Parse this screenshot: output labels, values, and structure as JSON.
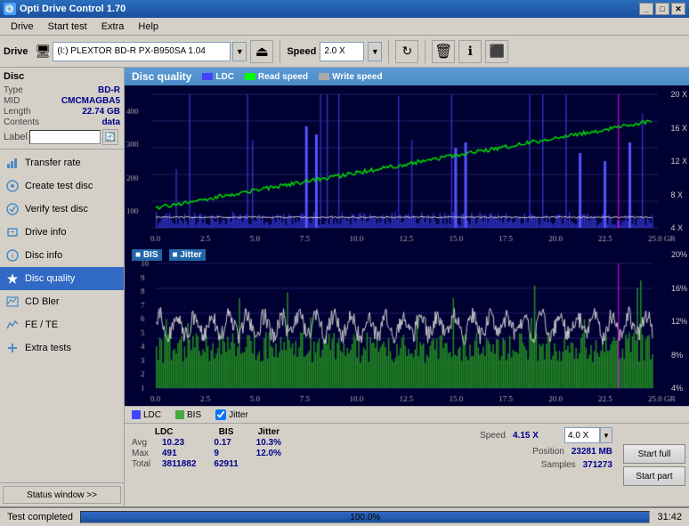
{
  "window": {
    "title": "Opti Drive Control 1.70",
    "titleIcon": "💿"
  },
  "menu": {
    "items": [
      "Drive",
      "Start test",
      "Extra",
      "Help"
    ]
  },
  "toolbar": {
    "drive_label": "Drive",
    "drive_icon": "🖥",
    "drive_value": "(I:)  PLEXTOR BD-R  PX-B950SA 1.04",
    "speed_label": "Speed",
    "speed_value": "2.0 X"
  },
  "disc": {
    "section_title": "Disc",
    "type_label": "Type",
    "type_value": "BD-R",
    "mid_label": "MID",
    "mid_value": "CMCMAGBA5",
    "length_label": "Length",
    "length_value": "22.74 GB",
    "contents_label": "Contents",
    "contents_value": "data",
    "label_label": "Label",
    "label_value": ""
  },
  "nav": {
    "items": [
      {
        "id": "transfer-rate",
        "label": "Transfer rate",
        "icon": "📈"
      },
      {
        "id": "create-test-disc",
        "label": "Create test disc",
        "icon": "💿"
      },
      {
        "id": "verify-test-disc",
        "label": "Verify test disc",
        "icon": "✓"
      },
      {
        "id": "drive-info",
        "label": "Drive info",
        "icon": "ℹ"
      },
      {
        "id": "disc-info",
        "label": "Disc info",
        "icon": "📋"
      },
      {
        "id": "disc-quality",
        "label": "Disc quality",
        "icon": "⭐",
        "active": true
      },
      {
        "id": "cd-bler",
        "label": "CD Bler",
        "icon": "📊"
      },
      {
        "id": "fe-te",
        "label": "FE / TE",
        "icon": "📉"
      },
      {
        "id": "extra-tests",
        "label": "Extra tests",
        "icon": "🔧"
      }
    ]
  },
  "sidebar_status": {
    "btn_label": "Status window >>"
  },
  "chart": {
    "title": "Disc quality",
    "legend": [
      {
        "label": "LDC",
        "color": "#0000ff"
      },
      {
        "label": "Read speed",
        "color": "#00ff00"
      },
      {
        "label": "Write speed",
        "color": "#cccccc"
      }
    ],
    "upper": {
      "y_labels": [
        "400",
        "300",
        "200",
        "100"
      ],
      "x_labels": [
        "0.0",
        "2.5",
        "5.0",
        "7.5",
        "10.0",
        "12.5",
        "15.0",
        "17.5",
        "20.0",
        "22.5",
        "25.0 GB"
      ],
      "y_right": [
        "20 X",
        "16 X",
        "12 X",
        "8 X",
        "4 X"
      ]
    },
    "lower": {
      "title": "BIS",
      "title2": "Jitter",
      "y_labels": [
        "10",
        "9",
        "8",
        "7",
        "6",
        "5",
        "4",
        "3",
        "2",
        "1"
      ],
      "y_right": [
        "20%",
        "16%",
        "12%",
        "8%",
        "4%"
      ],
      "x_labels": [
        "0.0",
        "2.5",
        "5.0",
        "7.5",
        "10.0",
        "12.5",
        "15.0",
        "17.5",
        "20.0",
        "22.5",
        "25.0 GB"
      ]
    }
  },
  "stats": {
    "legend": [
      {
        "label": "LDC",
        "color": "#4444ff"
      },
      {
        "label": "BIS",
        "color": "#44ff44"
      },
      {
        "label": "Jitter",
        "color": "#ffffff",
        "checked": true
      }
    ],
    "columns": [
      {
        "header": "LDC",
        "rows": [
          {
            "label": "Avg",
            "value": "10.23"
          },
          {
            "label": "Max",
            "value": "491"
          },
          {
            "label": "Total",
            "value": "3811882"
          }
        ]
      },
      {
        "header": "BIS",
        "rows": [
          {
            "label": "",
            "value": "0.17"
          },
          {
            "label": "",
            "value": "9"
          },
          {
            "label": "",
            "value": "62911"
          }
        ]
      },
      {
        "header": "Jitter",
        "rows": [
          {
            "label": "",
            "value": "10.3%"
          },
          {
            "label": "",
            "value": "12.0%"
          },
          {
            "label": "",
            "value": ""
          }
        ]
      }
    ],
    "right": {
      "speed_label": "Speed",
      "speed_value": "4.15 X",
      "speed_select": "4.0 X",
      "position_label": "Position",
      "position_value": "23281 MB",
      "samples_label": "Samples",
      "samples_value": "371273"
    },
    "buttons": [
      {
        "label": "Start full"
      },
      {
        "label": "Start part"
      }
    ]
  },
  "status_bar": {
    "text": "Test completed",
    "progress": 100,
    "progress_text": "100.0%",
    "time": "31:42"
  }
}
